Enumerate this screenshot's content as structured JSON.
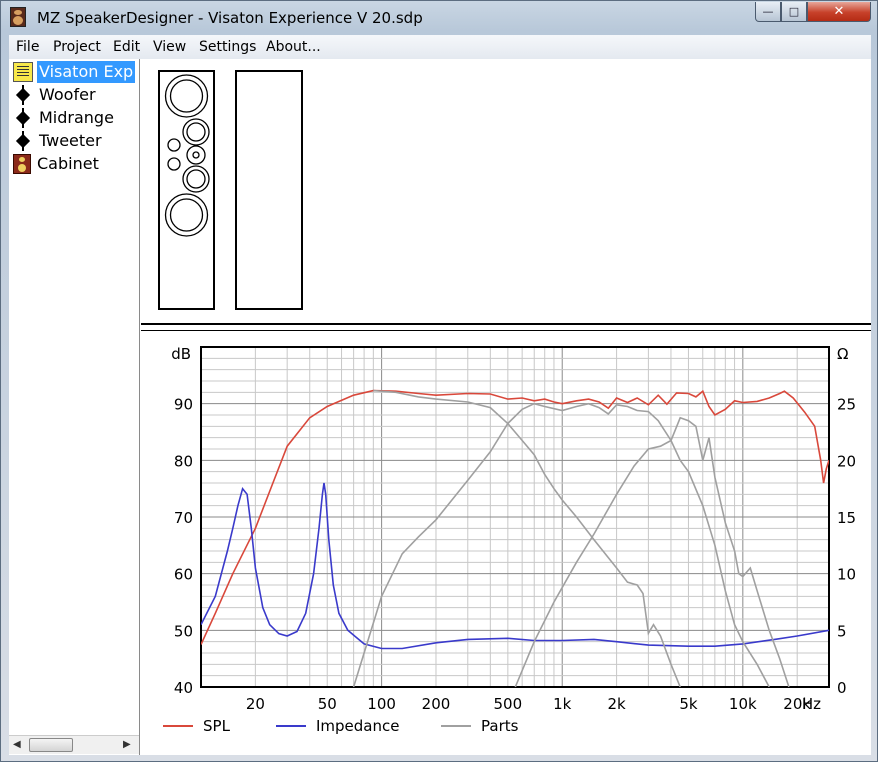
{
  "window": {
    "title": "MZ SpeakerDesigner - Visaton Experience V 20.sdp",
    "minimize": "—",
    "maximize": "□",
    "close": "✕"
  },
  "menu": [
    "File",
    "Project",
    "Edit",
    "View",
    "Settings",
    "About..."
  ],
  "tree": [
    {
      "label": "Visaton Exp",
      "icon": "project-icon",
      "selected": true
    },
    {
      "label": "Woofer",
      "icon": "driver-node-icon"
    },
    {
      "label": "Midrange",
      "icon": "driver-node-icon"
    },
    {
      "label": "Tweeter",
      "icon": "driver-node-icon"
    },
    {
      "label": "Cabinet",
      "icon": "cabinet-icon"
    }
  ],
  "scrollbar": {
    "left_arrow": "◀",
    "right_arrow": "▶"
  },
  "chart_data": {
    "type": "line",
    "x_scale": "log",
    "xlim": [
      10,
      30000
    ],
    "ylim_left": [
      40,
      100
    ],
    "ylim_right": [
      0,
      30
    ],
    "y_left_unit": "dB",
    "y_right_unit": "Ω",
    "x_unit": "Hz",
    "x_ticks": [
      {
        "value": 20,
        "label": "20"
      },
      {
        "value": 50,
        "label": "50"
      },
      {
        "value": 100,
        "label": "100"
      },
      {
        "value": 200,
        "label": "200"
      },
      {
        "value": 500,
        "label": "500"
      },
      {
        "value": 1000,
        "label": "1k"
      },
      {
        "value": 2000,
        "label": "2k"
      },
      {
        "value": 5000,
        "label": "5k"
      },
      {
        "value": 10000,
        "label": "10k"
      },
      {
        "value": 20000,
        "label": "20k"
      }
    ],
    "y_left_ticks": [
      40,
      50,
      60,
      70,
      80,
      90
    ],
    "y_right_ticks": [
      0,
      5,
      10,
      15,
      20,
      25
    ],
    "grid": true,
    "legend_position": "bottom",
    "series": [
      {
        "name": "SPL",
        "color": "#d9483b",
        "axis": "left",
        "points": [
          [
            10,
            47.5
          ],
          [
            12,
            53
          ],
          [
            15,
            60
          ],
          [
            20,
            68
          ],
          [
            25,
            76
          ],
          [
            30,
            82.5
          ],
          [
            40,
            87.5
          ],
          [
            50,
            89.5
          ],
          [
            70,
            91.5
          ],
          [
            90,
            92.3
          ],
          [
            120,
            92.2
          ],
          [
            160,
            91.8
          ],
          [
            200,
            91.5
          ],
          [
            300,
            91.8
          ],
          [
            400,
            91.7
          ],
          [
            500,
            90.8
          ],
          [
            600,
            91.0
          ],
          [
            700,
            90.5
          ],
          [
            800,
            90.8
          ],
          [
            900,
            90.3
          ],
          [
            1000,
            90.0
          ],
          [
            1200,
            90.5
          ],
          [
            1400,
            90.8
          ],
          [
            1600,
            90.3
          ],
          [
            1800,
            89.2
          ],
          [
            2000,
            91.0
          ],
          [
            2300,
            90.2
          ],
          [
            2600,
            91.0
          ],
          [
            3000,
            89.8
          ],
          [
            3400,
            91.5
          ],
          [
            3800,
            89.9
          ],
          [
            4300,
            91.9
          ],
          [
            5000,
            91.8
          ],
          [
            5500,
            91.2
          ],
          [
            6000,
            92.2
          ],
          [
            6500,
            89.5
          ],
          [
            7000,
            88.0
          ],
          [
            8000,
            89.0
          ],
          [
            9000,
            90.5
          ],
          [
            10000,
            90.2
          ],
          [
            12000,
            90.4
          ],
          [
            14000,
            91.0
          ],
          [
            16000,
            91.8
          ],
          [
            17000,
            92.2
          ],
          [
            19000,
            91.0
          ],
          [
            22000,
            88.5
          ],
          [
            25000,
            86.0
          ],
          [
            27000,
            80.0
          ],
          [
            28000,
            76.0
          ],
          [
            29000,
            78.5
          ],
          [
            30000,
            80.0
          ]
        ]
      },
      {
        "name": "Impedance",
        "color": "#3a3acb",
        "axis": "right",
        "points": [
          [
            10,
            5.5
          ],
          [
            12,
            8
          ],
          [
            14,
            12
          ],
          [
            15,
            14
          ],
          [
            16,
            16
          ],
          [
            17,
            17.5
          ],
          [
            18,
            17
          ],
          [
            19,
            14
          ],
          [
            20,
            10.5
          ],
          [
            22,
            7.0
          ],
          [
            24,
            5.5
          ],
          [
            27,
            4.7
          ],
          [
            30,
            4.5
          ],
          [
            34,
            4.9
          ],
          [
            38,
            6.5
          ],
          [
            42,
            10
          ],
          [
            45,
            14
          ],
          [
            47,
            17
          ],
          [
            48,
            18
          ],
          [
            49,
            17
          ],
          [
            51,
            13
          ],
          [
            54,
            9
          ],
          [
            58,
            6.5
          ],
          [
            65,
            5
          ],
          [
            80,
            3.8
          ],
          [
            100,
            3.4
          ],
          [
            130,
            3.4
          ],
          [
            200,
            3.9
          ],
          [
            300,
            4.2
          ],
          [
            500,
            4.3
          ],
          [
            700,
            4.1
          ],
          [
            1000,
            4.1
          ],
          [
            1500,
            4.2
          ],
          [
            2000,
            4.0
          ],
          [
            3000,
            3.7
          ],
          [
            5000,
            3.6
          ],
          [
            7000,
            3.6
          ],
          [
            10000,
            3.8
          ],
          [
            15000,
            4.2
          ],
          [
            20000,
            4.5
          ],
          [
            30000,
            5.0
          ]
        ]
      },
      {
        "name": "Parts",
        "color": "#a0a0a0",
        "axis": "left",
        "lines": [
          [
            [
              90,
              92.3
            ],
            [
              120,
              92.0
            ],
            [
              160,
              91.2
            ],
            [
              200,
              90.8
            ],
            [
              300,
              90.3
            ],
            [
              400,
              89.3
            ],
            [
              500,
              86.5
            ],
            [
              600,
              83.5
            ],
            [
              700,
              81.0
            ],
            [
              800,
              77.5
            ],
            [
              900,
              75.0
            ],
            [
              1000,
              73.0
            ],
            [
              1200,
              70.0
            ],
            [
              1500,
              66.0
            ],
            [
              2000,
              61.0
            ],
            [
              2300,
              58.5
            ],
            [
              2600,
              58.0
            ],
            [
              2800,
              56.5
            ],
            [
              3000,
              49.5
            ],
            [
              3200,
              51.0
            ],
            [
              3500,
              49.0
            ],
            [
              4000,
              44.0
            ],
            [
              4500,
              40.0
            ]
          ],
          [
            [
              70,
              40
            ],
            [
              80,
              46.0
            ],
            [
              100,
              56.0
            ],
            [
              130,
              63.5
            ],
            [
              160,
              66.5
            ],
            [
              200,
              69.5
            ],
            [
              300,
              76.5
            ],
            [
              400,
              81.5
            ],
            [
              500,
              86.5
            ],
            [
              600,
              89.0
            ],
            [
              700,
              90.0
            ],
            [
              800,
              89.5
            ],
            [
              1000,
              88.8
            ],
            [
              1200,
              89.5
            ],
            [
              1400,
              90.0
            ],
            [
              1600,
              89.3
            ],
            [
              1800,
              88.2
            ],
            [
              2000,
              89.8
            ],
            [
              2300,
              89.5
            ],
            [
              2600,
              88.8
            ],
            [
              3000,
              88.6
            ],
            [
              3400,
              87.0
            ],
            [
              4000,
              83.5
            ],
            [
              4500,
              80.0
            ],
            [
              5000,
              78.0
            ],
            [
              6000,
              72.0
            ],
            [
              7000,
              65.0
            ],
            [
              8000,
              57.0
            ],
            [
              9000,
              51.0
            ],
            [
              10000,
              48.0
            ],
            [
              12000,
              44.0
            ],
            [
              14000,
              40.0
            ]
          ],
          [
            [
              550,
              40
            ],
            [
              700,
              48.0
            ],
            [
              900,
              55.0
            ],
            [
              1200,
              62.0
            ],
            [
              1500,
              67.0
            ],
            [
              2000,
              74.0
            ],
            [
              2500,
              79.0
            ],
            [
              3000,
              82.0
            ],
            [
              3500,
              82.5
            ],
            [
              4000,
              83.5
            ],
            [
              4500,
              87.5
            ],
            [
              5000,
              87.0
            ],
            [
              5500,
              86.0
            ],
            [
              6000,
              80.0
            ],
            [
              6500,
              84.0
            ],
            [
              7000,
              77.0
            ],
            [
              8000,
              69.0
            ],
            [
              9000,
              64.0
            ],
            [
              9500,
              60.0
            ],
            [
              10000,
              59.5
            ],
            [
              11000,
              61.0
            ],
            [
              12000,
              57.0
            ],
            [
              14000,
              50.0
            ],
            [
              16000,
              45.0
            ],
            [
              18000,
              40.0
            ]
          ]
        ]
      }
    ]
  }
}
